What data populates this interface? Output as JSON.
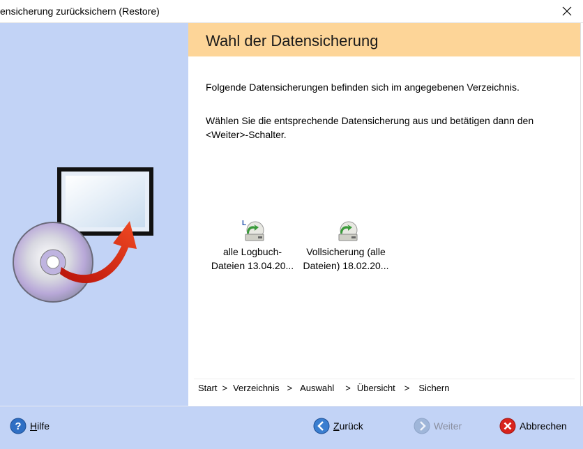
{
  "window": {
    "title": "ensicherung zurücksichern (Restore)",
    "close_icon": "close-icon"
  },
  "header": {
    "title": "Wahl der Datensicherung",
    "background": "#fdd598"
  },
  "sidebar": {
    "background": "#c2d3f6",
    "illustration": "restore-cd-monitor-illustration"
  },
  "main": {
    "paragraph1": "Folgende Datensicherungen befinden sich im angegebenen Verzeichnis.",
    "paragraph2": "Wählen Sie die entsprechende Datensicherung aus und betätigen dann den <Weiter>-Schalter.",
    "backups": [
      {
        "label": "alle Logbuch-Dateien 13.04.20...",
        "icon": "logbook-backup-icon"
      },
      {
        "label": "Vollsicherung (alle Dateien) 18.02.20...",
        "icon": "full-backup-icon"
      }
    ]
  },
  "breadcrumb": {
    "steps": [
      "Start",
      "Verzeichnis",
      "Auswahl",
      "Übersicht",
      "Sichern"
    ],
    "separator": ">"
  },
  "footer": {
    "help_mnemonic": "H",
    "help_rest": "ilfe",
    "back_mnemonic": "Z",
    "back_rest": "urück",
    "next_label": "Weiter",
    "cancel_label": "Abbrechen"
  }
}
